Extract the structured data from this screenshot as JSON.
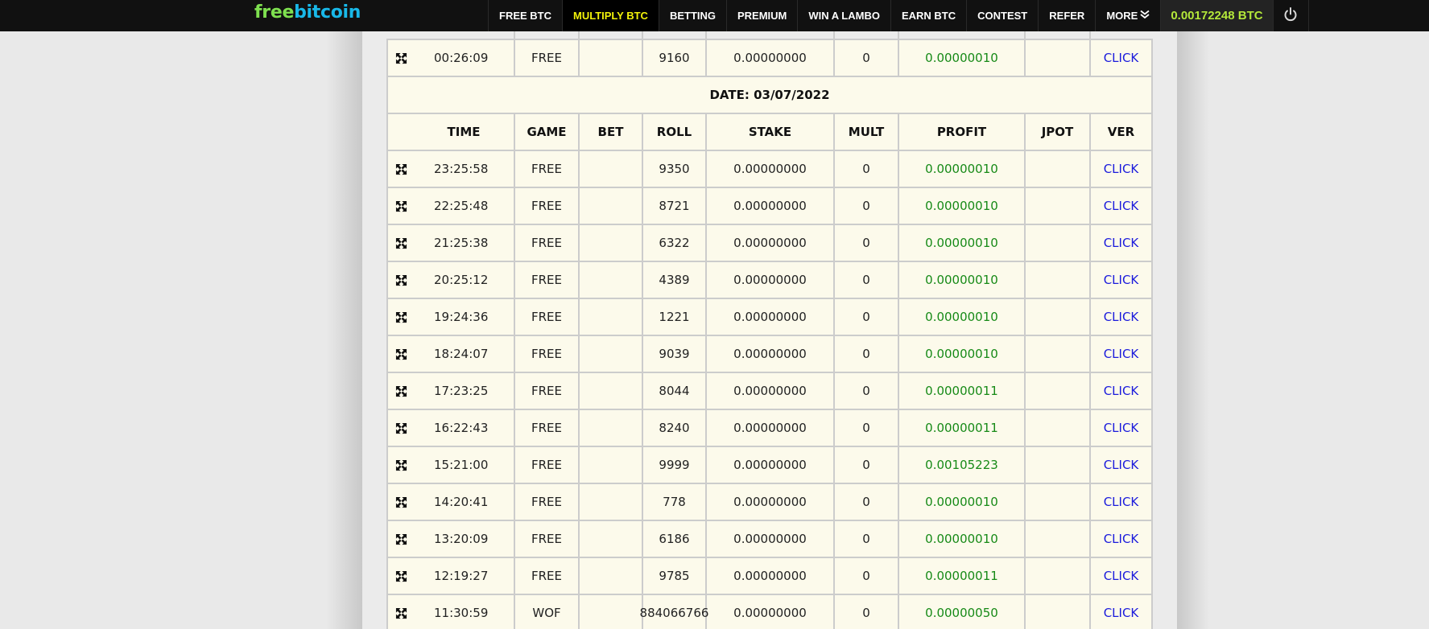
{
  "nav": {
    "logo_part1": "free",
    "logo_part2": "bitcoin",
    "items": [
      {
        "label": "FREE BTC",
        "active": false
      },
      {
        "label": "MULTIPLY BTC",
        "active": true
      },
      {
        "label": "BETTING",
        "active": false
      },
      {
        "label": "PREMIUM",
        "active": false
      },
      {
        "label": "WIN A LAMBO",
        "active": false
      },
      {
        "label": "EARN BTC",
        "active": false
      },
      {
        "label": "CONTEST",
        "active": false
      },
      {
        "label": "REFER",
        "active": false
      },
      {
        "label": "MORE",
        "active": false
      }
    ],
    "more_icon": "double-chevron-down-icon",
    "balance": "0.00172248 BTC",
    "power_icon": "power-icon"
  },
  "colors": {
    "nav_bg": "#111111",
    "active_nav_text": "#f2f20a",
    "balance_text": "#b4e83a",
    "logo_green": "#7ee04f",
    "logo_blue": "#19b8e8",
    "table_bg": "#fcfaeb",
    "profit": "#178a17",
    "link": "#1a1adc"
  },
  "history": {
    "prev_rows": [
      {
        "time": "00:26:09",
        "game": "FREE",
        "bet": "",
        "roll": "9160",
        "stake": "0.00000000",
        "mult": "0",
        "profit": "0.00000010",
        "jpot": "",
        "ver": "CLICK"
      }
    ],
    "date_label": "DATE: 03/07/2022",
    "columns": [
      "",
      "TIME",
      "GAME",
      "BET",
      "ROLL",
      "STAKE",
      "MULT",
      "PROFIT",
      "JPOT",
      "VER"
    ],
    "rows": [
      {
        "time": "23:25:58",
        "game": "FREE",
        "bet": "",
        "roll": "9350",
        "stake": "0.00000000",
        "mult": "0",
        "profit": "0.00000010",
        "jpot": "",
        "ver": "CLICK"
      },
      {
        "time": "22:25:48",
        "game": "FREE",
        "bet": "",
        "roll": "8721",
        "stake": "0.00000000",
        "mult": "0",
        "profit": "0.00000010",
        "jpot": "",
        "ver": "CLICK"
      },
      {
        "time": "21:25:38",
        "game": "FREE",
        "bet": "",
        "roll": "6322",
        "stake": "0.00000000",
        "mult": "0",
        "profit": "0.00000010",
        "jpot": "",
        "ver": "CLICK"
      },
      {
        "time": "20:25:12",
        "game": "FREE",
        "bet": "",
        "roll": "4389",
        "stake": "0.00000000",
        "mult": "0",
        "profit": "0.00000010",
        "jpot": "",
        "ver": "CLICK"
      },
      {
        "time": "19:24:36",
        "game": "FREE",
        "bet": "",
        "roll": "1221",
        "stake": "0.00000000",
        "mult": "0",
        "profit": "0.00000010",
        "jpot": "",
        "ver": "CLICK"
      },
      {
        "time": "18:24:07",
        "game": "FREE",
        "bet": "",
        "roll": "9039",
        "stake": "0.00000000",
        "mult": "0",
        "profit": "0.00000010",
        "jpot": "",
        "ver": "CLICK"
      },
      {
        "time": "17:23:25",
        "game": "FREE",
        "bet": "",
        "roll": "8044",
        "stake": "0.00000000",
        "mult": "0",
        "profit": "0.00000011",
        "jpot": "",
        "ver": "CLICK"
      },
      {
        "time": "16:22:43",
        "game": "FREE",
        "bet": "",
        "roll": "8240",
        "stake": "0.00000000",
        "mult": "0",
        "profit": "0.00000011",
        "jpot": "",
        "ver": "CLICK"
      },
      {
        "time": "15:21:00",
        "game": "FREE",
        "bet": "",
        "roll": "9999",
        "stake": "0.00000000",
        "mult": "0",
        "profit": "0.00105223",
        "jpot": "",
        "ver": "CLICK"
      },
      {
        "time": "14:20:41",
        "game": "FREE",
        "bet": "",
        "roll": "778",
        "stake": "0.00000000",
        "mult": "0",
        "profit": "0.00000010",
        "jpot": "",
        "ver": "CLICK"
      },
      {
        "time": "13:20:09",
        "game": "FREE",
        "bet": "",
        "roll": "6186",
        "stake": "0.00000000",
        "mult": "0",
        "profit": "0.00000010",
        "jpot": "",
        "ver": "CLICK"
      },
      {
        "time": "12:19:27",
        "game": "FREE",
        "bet": "",
        "roll": "9785",
        "stake": "0.00000000",
        "mult": "0",
        "profit": "0.00000011",
        "jpot": "",
        "ver": "CLICK"
      },
      {
        "time": "11:30:59",
        "game": "WOF",
        "bet": "",
        "roll": "884066766",
        "stake": "0.00000000",
        "mult": "0",
        "profit": "0.00000050",
        "jpot": "",
        "ver": "CLICK"
      }
    ],
    "row_icon": "expand-arrows-icon"
  }
}
